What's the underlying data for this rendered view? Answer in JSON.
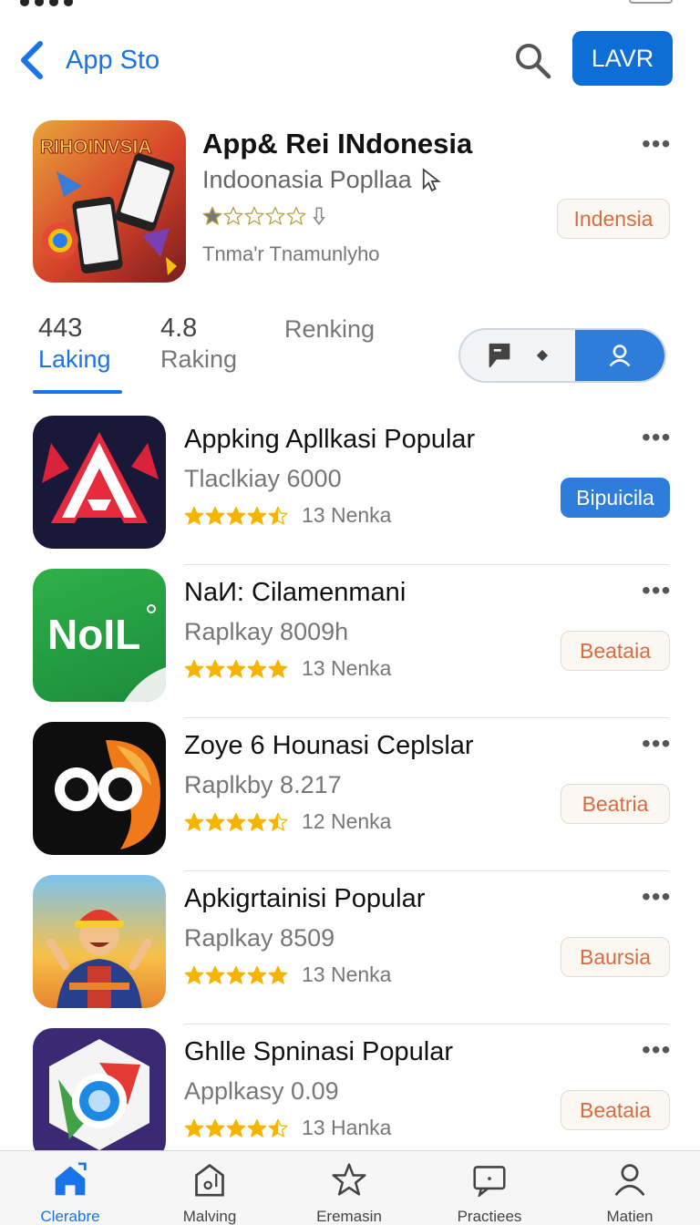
{
  "nav": {
    "back_label": "App Sto",
    "top_button": "LAVR"
  },
  "featured": {
    "icon_text": "RIHOINVSIA",
    "title": "App& Rei INdonesia",
    "subtitle": "Indoonasia Popllaa",
    "rating": 1,
    "developer": "Tnma'r Tnamunlyho",
    "badge": "Indensia",
    "more": "•••"
  },
  "stats": [
    {
      "value": "443",
      "label": "Laking",
      "active": true
    },
    {
      "value": "4.8",
      "label": "Raking",
      "active": false
    },
    {
      "value": "",
      "label": "Renking",
      "active": false
    }
  ],
  "apps": [
    {
      "title": "Appking Apllkasi Popular",
      "subtitle": "Tlaclkiay 6000",
      "rating": 4.5,
      "count": "13 Nenka",
      "action": "Bipuicila",
      "action_style": "filled",
      "icon": "letter-a-icon",
      "more": "•••"
    },
    {
      "title": "NaИ: Cilamenmani",
      "subtitle": "Raplkay 8009h",
      "rating": 5,
      "count": "13 Nenka",
      "action": "Beataia",
      "action_style": "outline",
      "icon": "noil-icon",
      "icon_text": "NoIL",
      "more": "•••"
    },
    {
      "title": "Zoye 6 Hounasi Ceplslar",
      "subtitle": "Raplkby 8.217",
      "rating": 4.5,
      "count": "12 Nenka",
      "action": "Beatria",
      "action_style": "outline",
      "icon": "owl-icon",
      "more": "•••"
    },
    {
      "title": "Apkigrtainisi Popular",
      "subtitle": "Raplkay 8509",
      "rating": 5,
      "count": "13 Nenka",
      "action": "Baursia",
      "action_style": "outline",
      "icon": "character-icon",
      "more": "•••"
    },
    {
      "title": "Ghlle Spninasi Popular",
      "subtitle": "Applkasy 0.09",
      "rating": 4.5,
      "count": "13 Hanka",
      "action": "Beataia",
      "action_style": "outline",
      "icon": "chrome-icon",
      "more": "•••"
    }
  ],
  "tabs": [
    {
      "label": "Clerabre",
      "icon": "home-icon",
      "active": true
    },
    {
      "label": "Malving",
      "icon": "building-icon",
      "active": false
    },
    {
      "label": "Eremasin",
      "icon": "star-icon",
      "active": false
    },
    {
      "label": "Practiees",
      "icon": "message-icon",
      "active": false
    },
    {
      "label": "Matien",
      "icon": "person-icon",
      "active": false
    }
  ],
  "colors": {
    "accent": "#1a73e8",
    "button_blue": "#0d6ed8",
    "badge_text": "#d86c3f",
    "star": "#f4b400"
  }
}
